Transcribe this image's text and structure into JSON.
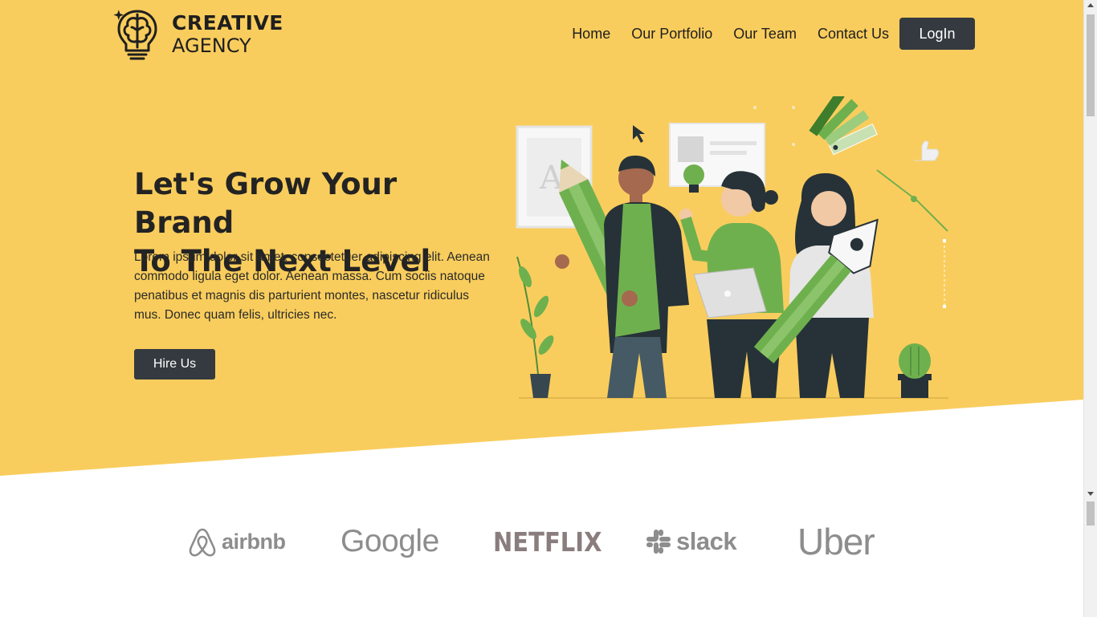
{
  "colors": {
    "hero_bg": "#f9cd5d",
    "button_bg": "#343a40",
    "illustration_green": "#6fb04e",
    "brand_gray": "#8d8d8d"
  },
  "logo": {
    "line1": "CREATIVE",
    "line2": "AGENCY",
    "icon": "lightbulb-brain-icon"
  },
  "nav": {
    "links": [
      "Home",
      "Our Portfolio",
      "Our Team",
      "Contact Us"
    ],
    "login_label": "LogIn"
  },
  "hero": {
    "title_line1": "Let's Grow Your Brand",
    "title_line2": "To The Next Level",
    "description": "Lorem ipsum dolor sit amet, consectetuer adipiscing elit. Aenean commodo ligula eget dolor. Aenean massa. Cum sociis natoque penatibus et magnis dis parturient montes, nascetur ridiculus mus. Donec quam felis, ultricies nec.",
    "cta_label": "Hire Us",
    "illustration": "team-creative-illustration"
  },
  "brands": [
    {
      "name": "airbnb",
      "icon": "airbnb-logo-icon"
    },
    {
      "name": "Google"
    },
    {
      "name": "NETFLIX"
    },
    {
      "name": "slack",
      "icon": "slack-logo-icon"
    },
    {
      "name": "Uber"
    }
  ]
}
